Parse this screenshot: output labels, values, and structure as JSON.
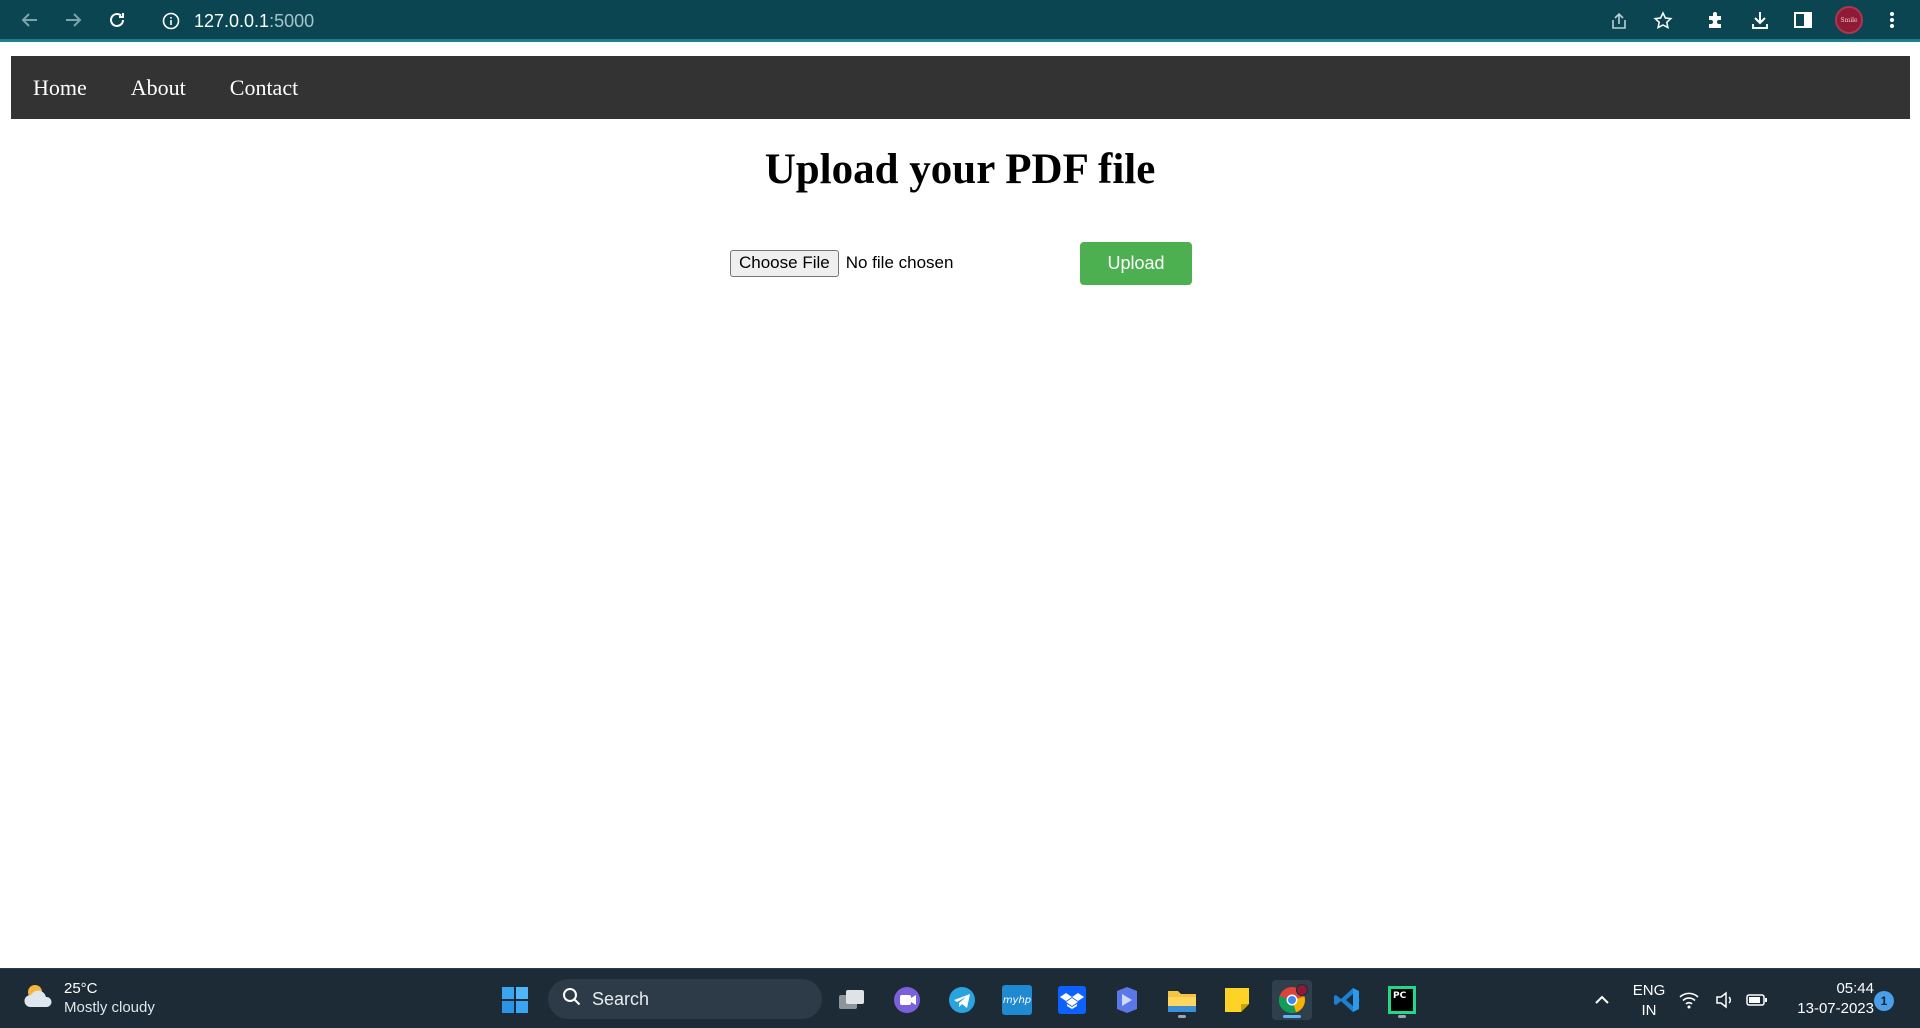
{
  "browser": {
    "url_host": "127.0.0.1",
    "url_port": ":5000",
    "icons": [
      "back-icon",
      "forward-icon",
      "reload-icon",
      "info-icon",
      "share-icon",
      "bookmark-star-icon",
      "extensions-icon",
      "download-icon",
      "side-panel-icon",
      "profile-avatar",
      "kebab-menu-icon"
    ],
    "profile_initials": "Smile"
  },
  "site": {
    "nav": [
      {
        "label": "Home"
      },
      {
        "label": "About"
      },
      {
        "label": "Contact"
      }
    ],
    "title": "Upload your PDF file",
    "form": {
      "choose_file_label": "Choose File",
      "file_status": "No file chosen",
      "upload_label": "Upload"
    },
    "colors": {
      "nav_bg": "#333333",
      "upload_bg": "#4caf50"
    }
  },
  "taskbar": {
    "weather": {
      "temp": "25°C",
      "condition": "Mostly cloudy"
    },
    "search_label": "Search",
    "apps": [
      "windows-start-icon",
      "task-view-icon",
      "teams-chat-icon",
      "telegram-icon",
      "myhp-icon",
      "dropbox-icon",
      "copilot-icon",
      "file-explorer-icon",
      "sticky-notes-icon",
      "chrome-icon",
      "vscode-icon",
      "pycharm-icon"
    ],
    "myhp_text": "myhp",
    "pycharm_text": "PC",
    "tray": {
      "language_line1": "ENG",
      "language_line2": "IN",
      "time": "05:44",
      "date": "13-07-2023",
      "notifications": "1"
    }
  }
}
